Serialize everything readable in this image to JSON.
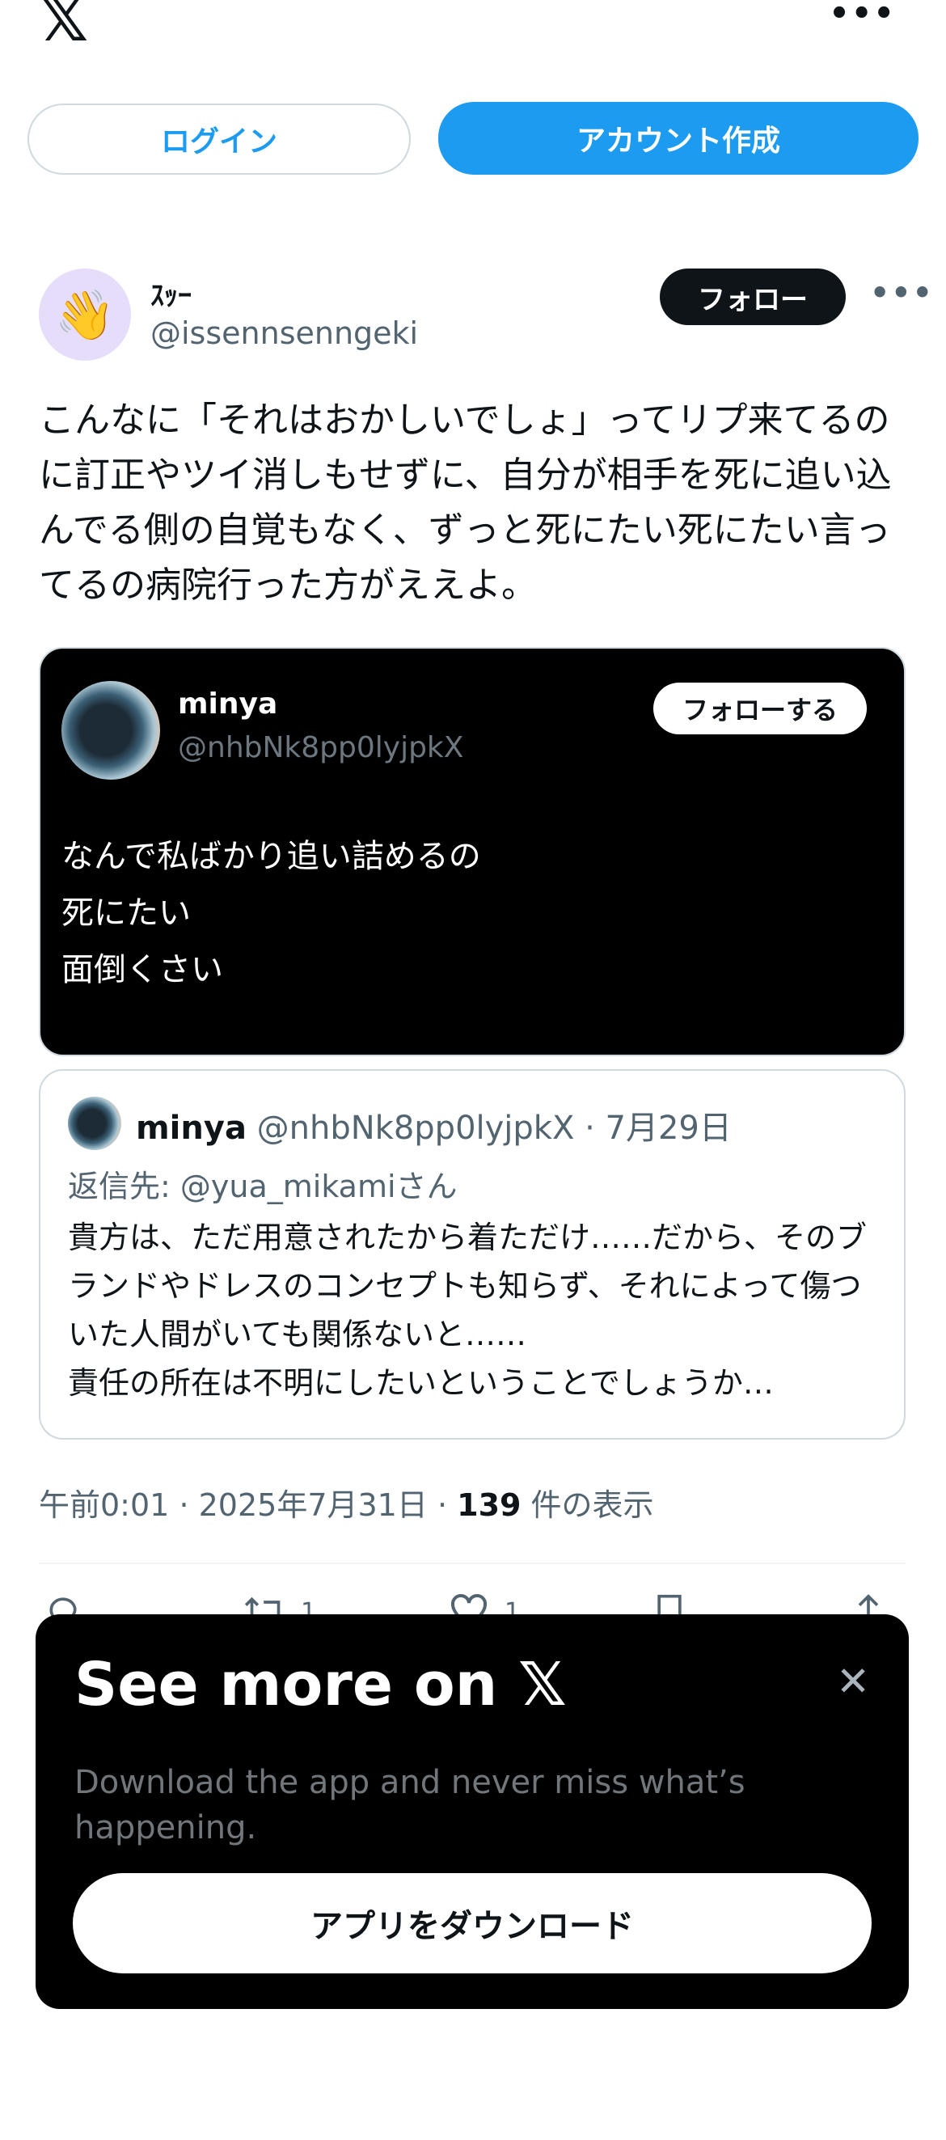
{
  "header": {
    "logo": "𝕏",
    "more": "•••",
    "login_label": "ログイン",
    "create_account_label": "アカウント作成"
  },
  "author": {
    "avatar_emoji": "👋",
    "name": "ｽｯｰ",
    "handle": "@issennsenngeki",
    "follow_label": "フォロー",
    "more": "•••"
  },
  "tweet": {
    "text": "こんなに「それはおかしいでしょ」ってリプ来てるのに訂正やツイ消しもせずに、自分が相手を死に追い込んでる側の自覚もなく、ずっと死にたい死にたい言ってるの病院行った方がええよ。"
  },
  "image_card": {
    "name": "minya",
    "handle": "@nhbNk8pp0lyjpkX",
    "follow_label": "フォローする",
    "text": "なんで私ばかり追い詰めるの\n死にたい\n面倒くさい"
  },
  "quote": {
    "name": "minya",
    "handle": "@nhbNk8pp0lyjpkX",
    "date": "7月29日",
    "reply_to": "返信先: @yua_mikamiさん",
    "text": "貴方は、ただ用意されたから着ただけ……だから、そのブランドやドレスのコンセプトも知らず、それによって傷ついた人間がいても関係ないと……\n責任の所在は不明にしたいということでしょうか…"
  },
  "meta": {
    "time": "午前0:01",
    "date": "2025年7月31日",
    "views": "139",
    "views_label": "件の表示"
  },
  "actions": {
    "reply_icon": "reply-icon",
    "retweet_count": "1",
    "like_count": "1"
  },
  "sheet": {
    "title": "See more on 𝕏",
    "close": "✕",
    "description": "Download the app and never miss what’s happening.",
    "download_label": "アプリをダウンロード"
  }
}
